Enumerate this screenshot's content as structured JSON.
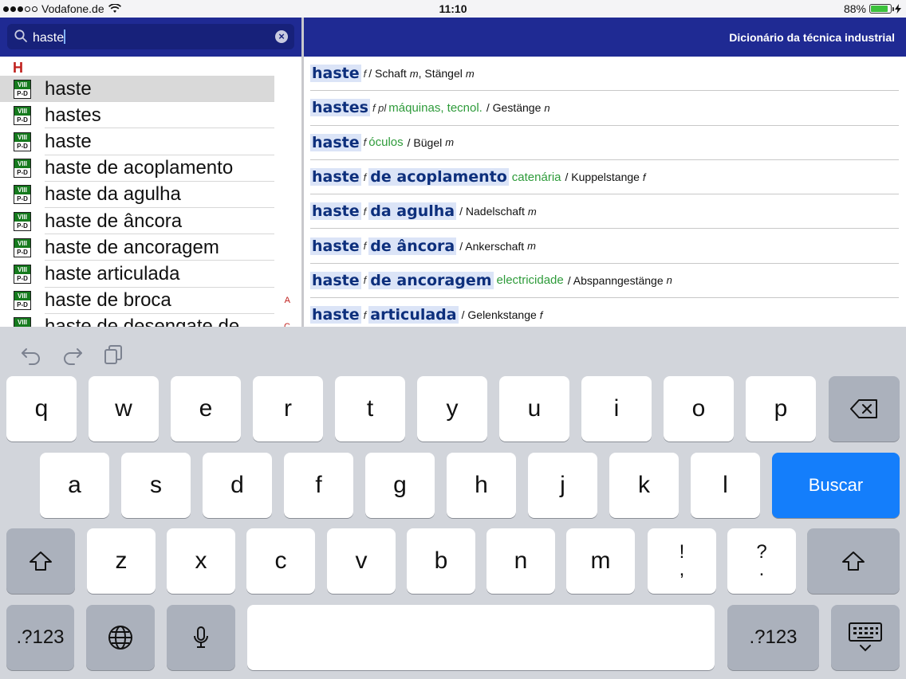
{
  "statusbar": {
    "carrier": "Vodafone.de",
    "time": "11:10",
    "battery_text": "88%",
    "battery_level": 0.88,
    "charging": true
  },
  "search": {
    "value": "haste"
  },
  "left_list": {
    "section_letter": "H",
    "icon_top": "VIII",
    "icon_bottom": "P-D",
    "items": [
      {
        "label": "haste",
        "index": ""
      },
      {
        "label": "hastes",
        "index": ""
      },
      {
        "label": "haste",
        "index": ""
      },
      {
        "label": "haste de acoplamento",
        "index": ""
      },
      {
        "label": "haste da agulha",
        "index": ""
      },
      {
        "label": "haste de âncora",
        "index": ""
      },
      {
        "label": "haste de ancoragem",
        "index": ""
      },
      {
        "label": "haste articulada",
        "index": ""
      },
      {
        "label": "haste de broca",
        "index": "A"
      },
      {
        "label": "haste de desengate de",
        "index": "C"
      }
    ]
  },
  "right_pane": {
    "title": "Dicionário da técnica industrial",
    "entries": [
      {
        "head": "haste",
        "gram": "f",
        "rest": "",
        "ctx": "",
        "trans": "/ Schaft",
        "tg": "m",
        "trans2": ", Stängel",
        "tg2": "m"
      },
      {
        "head": "hastes",
        "gram": "f pl",
        "rest": "",
        "ctx": "máquinas, tecnol.",
        "trans": "/ Gestänge",
        "tg": "n",
        "trans2": "",
        "tg2": ""
      },
      {
        "head": "haste",
        "gram": "f",
        "rest": "",
        "ctx": "óculos",
        "trans": "/ Bügel",
        "tg": "m",
        "trans2": "",
        "tg2": ""
      },
      {
        "head": "haste",
        "gram": "f",
        "rest": "de acoplamento",
        "ctx": "catenária",
        "trans": "/ Kuppelstange",
        "tg": "f",
        "trans2": "",
        "tg2": ""
      },
      {
        "head": "haste",
        "gram": "f",
        "rest": "da agulha",
        "ctx": "",
        "trans": "/ Nadelschaft",
        "tg": "m",
        "trans2": "",
        "tg2": ""
      },
      {
        "head": "haste",
        "gram": "f",
        "rest": "de âncora",
        "ctx": "",
        "trans": "/ Ankerschaft",
        "tg": "m",
        "trans2": "",
        "tg2": ""
      },
      {
        "head": "haste",
        "gram": "f",
        "rest": "de ancoragem",
        "ctx": "electricidade",
        "trans": "/ Abspanngestänge",
        "tg": "n",
        "trans2": "",
        "tg2": ""
      },
      {
        "head": "haste",
        "gram": "f",
        "rest": "articulada",
        "ctx": "",
        "trans": "/ Gelenkstange",
        "tg": "f",
        "trans2": "",
        "tg2": ""
      }
    ]
  },
  "keyboard": {
    "row1": [
      "q",
      "w",
      "e",
      "r",
      "t",
      "y",
      "u",
      "i",
      "o",
      "p"
    ],
    "row2": [
      "a",
      "s",
      "d",
      "f",
      "g",
      "h",
      "j",
      "k",
      "l"
    ],
    "row3": [
      "z",
      "x",
      "c",
      "v",
      "b",
      "n",
      "m"
    ],
    "punct1": [
      "!",
      ","
    ],
    "punct2": [
      "?",
      "."
    ],
    "search_label": "Buscar",
    "numbers_label": ".?123"
  }
}
